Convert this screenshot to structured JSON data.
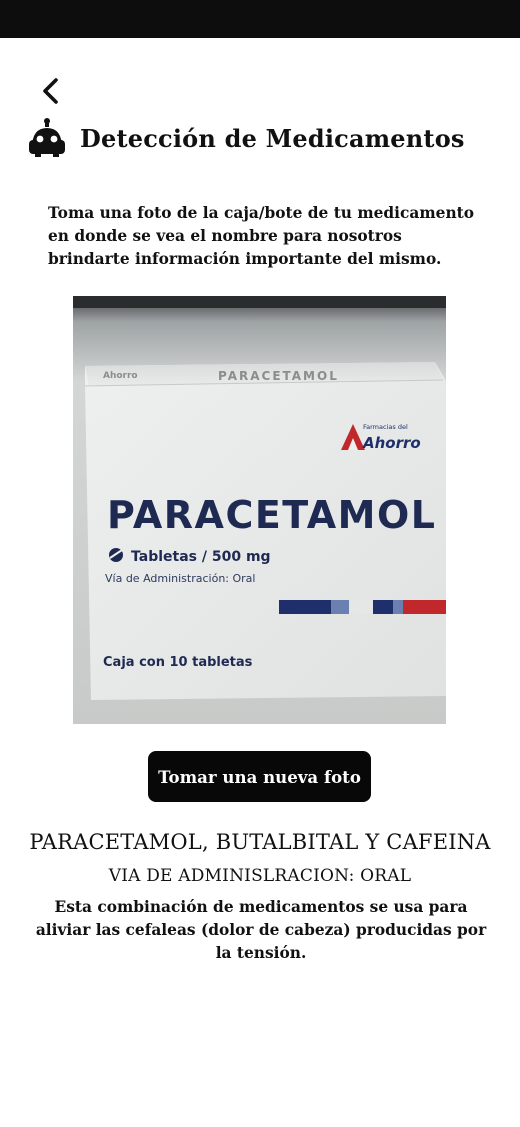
{
  "header": {
    "title": "Detección de Medicamentos",
    "back_icon": "chevron-left-icon",
    "robot_icon": "robot-icon"
  },
  "instructions": "Toma una foto de la caja/bote de tu medicamento en donde se vea el nombre para nosotros brindarte información importante del mismo.",
  "photo": {
    "brand_top_left": "Ahorro",
    "box_header_text": "PARACETAMOL",
    "brand_line1": "Farmacias del",
    "brand_line2": "Ahorro",
    "product_name": "PARACETAMOL",
    "dosage": "Tabletas / 500 mg",
    "route": "Vía de Administración: Oral",
    "box_count": "Caja con 10 tabletas"
  },
  "actions": {
    "new_photo_label": "Tomar una nueva foto"
  },
  "result": {
    "name": "PARACETAMOL, BUTALBITAL Y CAFEINA",
    "route": "VIA DE ADMINISLRACION: ORAL",
    "description": "Esta combinación de medicamentos se usa para aliviar las cefaleas (dolor de cabeza) producidas por la tensión."
  },
  "colors": {
    "status_bar": "#0d0d0d",
    "button_bg": "#080808",
    "button_text": "#ffffff",
    "brand_red": "#c0282c",
    "brand_navy": "#1f2f6b"
  }
}
